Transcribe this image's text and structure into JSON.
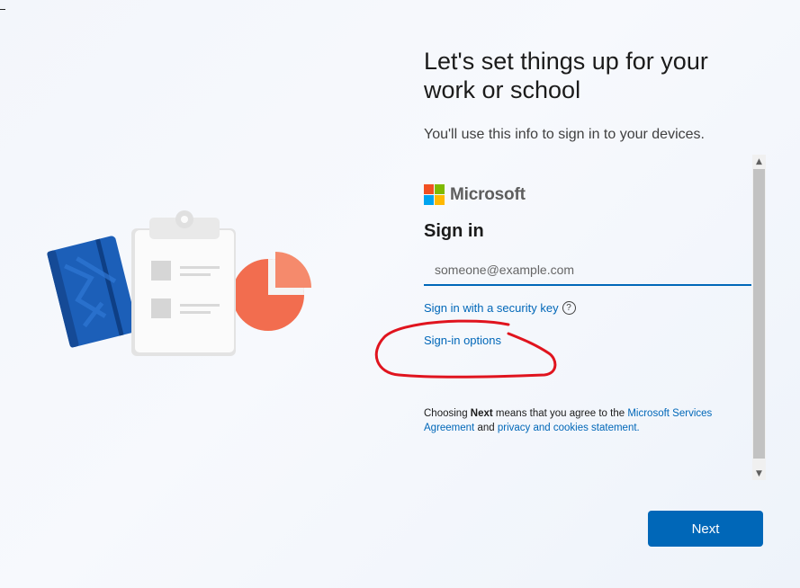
{
  "header": {
    "title": "Let's set things up for your work or school",
    "subtitle": "You'll use this info to sign in to your devices."
  },
  "signin": {
    "brand": "Microsoft",
    "heading": "Sign in",
    "email_placeholder": "someone@example.com",
    "security_key_link": "Sign in with a security key",
    "help_icon": "?",
    "options_link": "Sign-in options",
    "agreement": {
      "prefix": "Choosing ",
      "bold": "Next",
      "middle": " means that you agree to the ",
      "link1": "Microsoft Services Agreement",
      "and": " and ",
      "link2": "privacy and cookies statement."
    }
  },
  "footer": {
    "next_label": "Next"
  },
  "icons": {
    "scroll_up": "chevron-up-icon",
    "scroll_down": "chevron-down-icon",
    "illustration": "notebook-clipboard-chart-illustration"
  },
  "colors": {
    "accent": "#0067b8",
    "ms_red": "#f25022",
    "ms_green": "#7fba00",
    "ms_blue": "#00a4ef",
    "ms_yellow": "#ffb900",
    "annotation": "#e0141e"
  }
}
